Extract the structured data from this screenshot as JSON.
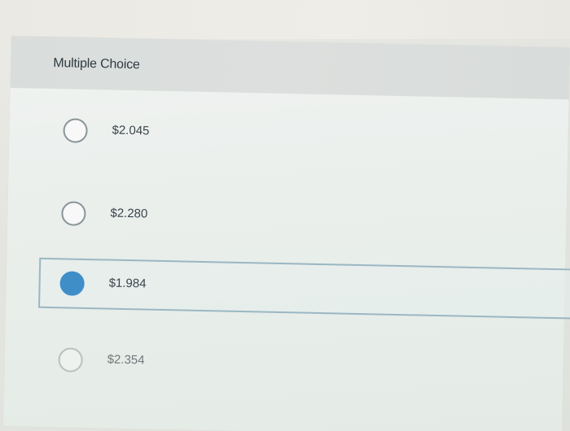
{
  "question": {
    "type_label": "Multiple Choice",
    "choices": [
      {
        "label": "$2.045",
        "selected": false
      },
      {
        "label": "$2.280",
        "selected": false
      },
      {
        "label": "$1.984",
        "selected": true
      },
      {
        "label": "$2.354",
        "selected": false
      }
    ]
  },
  "colors": {
    "selected_radio": "#3f8ec8",
    "selected_border": "#9bb7c3",
    "header_bg": "#dadedc"
  }
}
